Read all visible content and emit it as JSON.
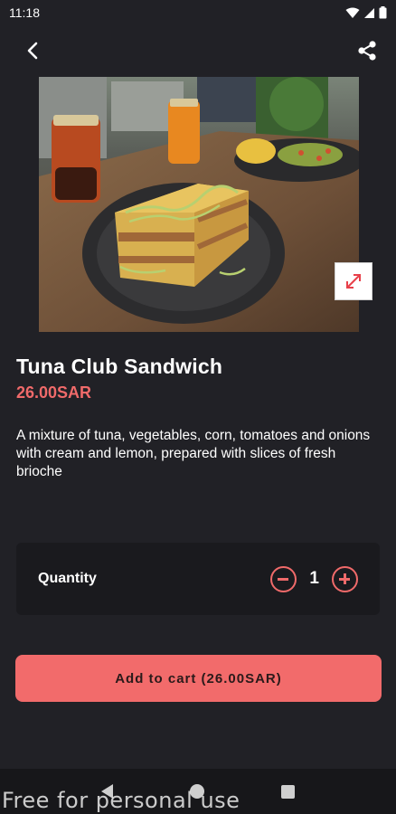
{
  "status_bar": {
    "time": "11:18"
  },
  "app_bar": {
    "back_icon": "back-arrow-icon",
    "share_icon": "share-icon"
  },
  "product": {
    "name": "Tuna Club Sandwich",
    "price": "26.00SAR",
    "description": "A mixture of tuna, vegetables, corn, tomatoes and onions with cream and lemon, prepared with slices of fresh brioche"
  },
  "quantity": {
    "label": "Quantity",
    "value": "1"
  },
  "cart": {
    "button_label": "Add to cart (26.00SAR)"
  },
  "watermark": "Free for personal use",
  "colors": {
    "accent": "#f26b6b",
    "background": "#212126",
    "card": "#1a1a1e"
  }
}
